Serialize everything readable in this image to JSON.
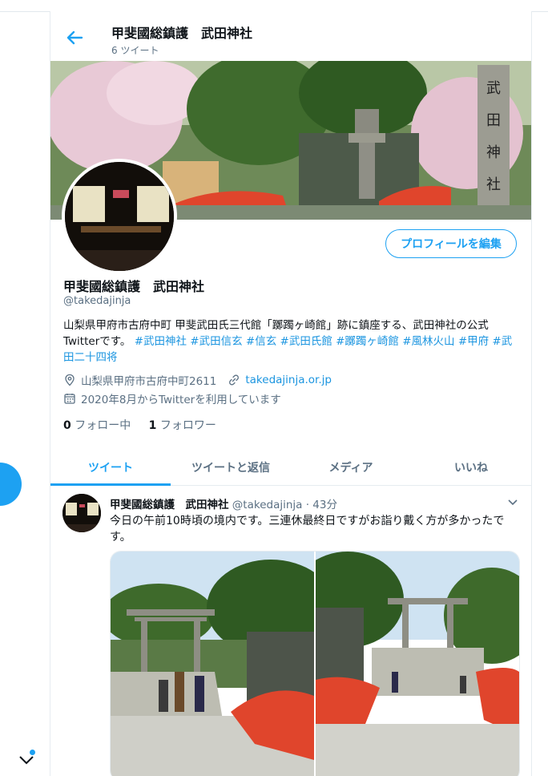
{
  "header": {
    "title": "甲斐國総鎮護　武田神社",
    "tweet_count": "6 ツイート"
  },
  "profile": {
    "edit_label": "プロフィールを編集",
    "name": "甲斐國総鎮護　武田神社",
    "handle": "@takedajinja",
    "bio_text": "山梨県甲府市古府中町 甲斐武田氏三代館「躑躅ヶ崎館」跡に鎮座する、武田神社の公式Twitterです。",
    "bio_tags": "#武田神社 #武田信玄 #信玄 #武田氏館 #躑躅ヶ崎館 #風林火山 #甲府 #武田二十四将",
    "location": "山梨県甲府市古府中町2611",
    "url": "takedajinja.or.jp",
    "joined": "2020年8月からTwitterを利用しています",
    "following_count": "0",
    "following_label": "フォロー中",
    "followers_count": "1",
    "followers_label": "フォロワー"
  },
  "tabs": [
    "ツイート",
    "ツイートと返信",
    "メディア",
    "いいね"
  ],
  "tweet": {
    "name": "甲斐國総鎮護　武田神社",
    "handle_time": "@takedajinja · 43分",
    "text": "今日の午前10時頃の境内です。三連休最終日ですがお詣り戴く方が多かったです。"
  },
  "colors": {
    "accent": "#1da1f2",
    "bridge": "#e0452c"
  },
  "icons": [
    "back-arrow-icon",
    "location-icon",
    "link-icon",
    "calendar-icon",
    "chevron-down-icon",
    "compose-fab-icon"
  ]
}
